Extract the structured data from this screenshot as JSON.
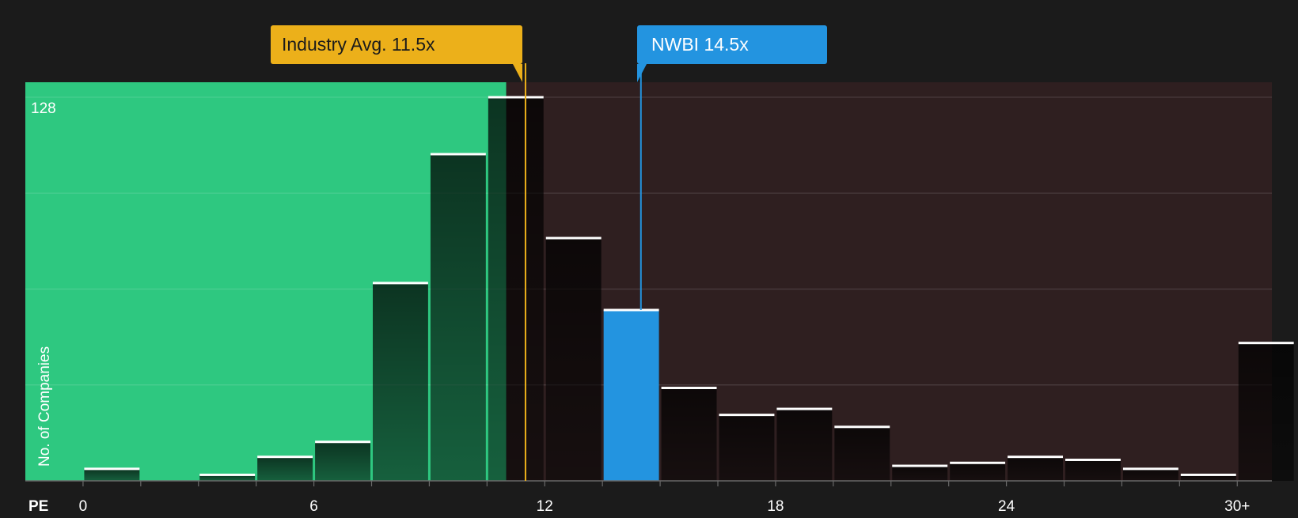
{
  "colors": {
    "background": "#1b1b1b",
    "below_region": "#2ec880",
    "above_region": "#2f1f20",
    "bar_fill": "#000000",
    "bar_cap": "#ffffff",
    "highlight_bar": "#2394e0",
    "industry_label_bg": "#ecb01a",
    "industry_label_text": "#1b1b1b",
    "company_label_bg": "#2394e0",
    "company_label_text": "#ffffff",
    "tick_text": "#ffffff"
  },
  "labels": {
    "industry_avg": "Industry Avg. 11.5x",
    "company": "NWBI 14.5x"
  },
  "chart_data": {
    "type": "bar",
    "title": "",
    "xlabel": "PE",
    "ylabel": "No. of Companies",
    "xlim": [
      -1.5,
      30.9
    ],
    "ylim": [
      0,
      133
    ],
    "x_ticks": [
      {
        "value": 0,
        "label": "0"
      },
      {
        "value": 6,
        "label": "6"
      },
      {
        "value": 12,
        "label": "12"
      },
      {
        "value": 18,
        "label": "18"
      },
      {
        "value": 24,
        "label": "24"
      },
      {
        "value": 30,
        "label": "30+"
      }
    ],
    "y_tick_labels": [
      {
        "value": 128,
        "label": "128"
      }
    ],
    "gridlines_y": [
      32,
      64,
      96,
      128
    ],
    "bin_width": 1.5,
    "bars": [
      {
        "x_start": 0.0,
        "x_end": 1.5,
        "value": 4
      },
      {
        "x_start": 1.5,
        "x_end": 3.0,
        "value": 0
      },
      {
        "x_start": 3.0,
        "x_end": 4.5,
        "value": 2
      },
      {
        "x_start": 4.5,
        "x_end": 6.0,
        "value": 8
      },
      {
        "x_start": 6.0,
        "x_end": 7.5,
        "value": 13
      },
      {
        "x_start": 7.5,
        "x_end": 9.0,
        "value": 66
      },
      {
        "x_start": 9.0,
        "x_end": 10.5,
        "value": 109
      },
      {
        "x_start": 10.5,
        "x_end": 12.0,
        "value": 128
      },
      {
        "x_start": 12.0,
        "x_end": 13.5,
        "value": 81
      },
      {
        "x_start": 13.5,
        "x_end": 15.0,
        "value": 57,
        "highlight": true
      },
      {
        "x_start": 15.0,
        "x_end": 16.5,
        "value": 31
      },
      {
        "x_start": 16.5,
        "x_end": 18.0,
        "value": 22
      },
      {
        "x_start": 18.0,
        "x_end": 19.5,
        "value": 24
      },
      {
        "x_start": 19.5,
        "x_end": 21.0,
        "value": 18
      },
      {
        "x_start": 21.0,
        "x_end": 22.5,
        "value": 5
      },
      {
        "x_start": 22.5,
        "x_end": 24.0,
        "value": 6
      },
      {
        "x_start": 24.0,
        "x_end": 25.5,
        "value": 8
      },
      {
        "x_start": 25.5,
        "x_end": 27.0,
        "value": 7
      },
      {
        "x_start": 27.0,
        "x_end": 28.5,
        "value": 4
      },
      {
        "x_start": 28.5,
        "x_end": 30.0,
        "value": 2
      },
      {
        "x_start": 30.0,
        "x_end": 31.5,
        "value": 46
      }
    ],
    "industry_avg": 11.5,
    "company_value": 14.5,
    "below_region_end": 11.0,
    "grid": true
  }
}
